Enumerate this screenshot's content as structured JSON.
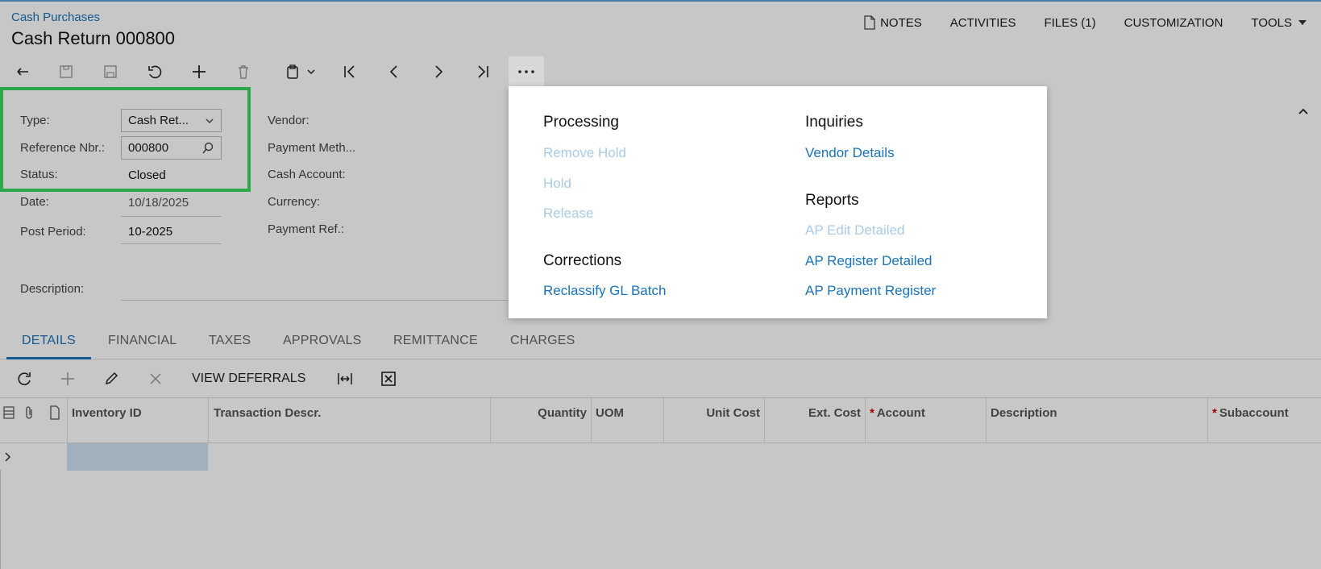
{
  "breadcrumb": "Cash Purchases",
  "title": "Cash Return 000800",
  "topmenu": {
    "notes": "NOTES",
    "activities": "ACTIVITIES",
    "files": "FILES (1)",
    "customization": "CUSTOMIZATION",
    "tools": "TOOLS"
  },
  "form": {
    "type_label": "Type:",
    "type_value": "Cash Ret...",
    "ref_label": "Reference Nbr.:",
    "ref_value": "000800",
    "status_label": "Status:",
    "status_value": "Closed",
    "date_label": "Date:",
    "date_value": "10/18/2025",
    "period_label": "Post Period:",
    "period_value": "10-2025",
    "desc_label": "Description:",
    "vendor_label": "Vendor:",
    "paymeth_label": "Payment Meth...",
    "cashacct_label": "Cash Account:",
    "currency_label": "Currency:",
    "payref_label": "Payment Ref.:"
  },
  "tabs": [
    "DETAILS",
    "FINANCIAL",
    "TAXES",
    "APPROVALS",
    "REMITTANCE",
    "CHARGES"
  ],
  "gridbar": {
    "view_deferrals": "VIEW DEFERRALS"
  },
  "grid": {
    "columns": {
      "inventory_id": "Inventory ID",
      "trans_descr": "Transaction Descr.",
      "quantity": "Quantity",
      "uom": "UOM",
      "unit_cost": "Unit Cost",
      "ext_cost": "Ext. Cost",
      "account": "Account",
      "description": "Description",
      "subaccount": "Subaccount"
    },
    "required_mark": "*"
  },
  "popup": {
    "processing": "Processing",
    "remove_hold": "Remove Hold",
    "hold": "Hold",
    "release": "Release",
    "corrections": "Corrections",
    "reclassify": "Reclassify GL Batch",
    "inquiries": "Inquiries",
    "vendor_details": "Vendor Details",
    "reports": "Reports",
    "ap_edit_detailed": "AP Edit Detailed",
    "ap_register_detailed": "AP Register Detailed",
    "ap_payment_register": "AP Payment Register"
  },
  "colors": {
    "link": "#1a73b8",
    "disabled_link": "#a9cbe6",
    "highlight_box": "#2aa84a"
  }
}
